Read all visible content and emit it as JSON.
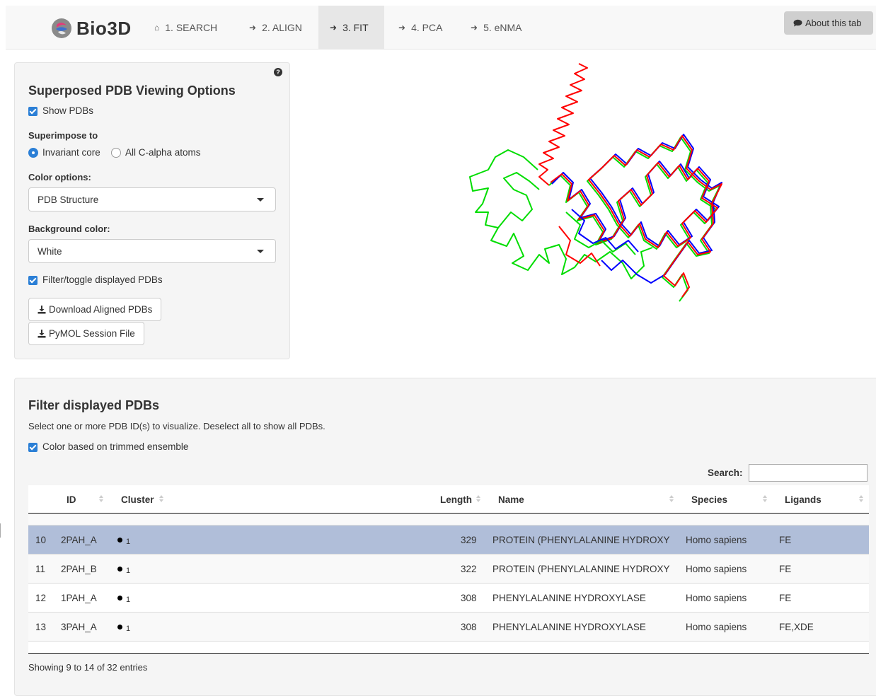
{
  "brand": {
    "name": "Bio3D"
  },
  "nav": {
    "items": [
      {
        "icon": "⌂",
        "label": "1. SEARCH"
      },
      {
        "icon": "➜",
        "label": "2. ALIGN"
      },
      {
        "icon": "➜",
        "label": "3. FIT"
      },
      {
        "icon": "➜",
        "label": "4. PCA"
      },
      {
        "icon": "➜",
        "label": "5. eNMA"
      }
    ],
    "active": "3. FIT",
    "about_label": "About this tab"
  },
  "options": {
    "title": "Superposed PDB Viewing Options",
    "show_pdbs_label": "Show PDBs",
    "show_pdbs_checked": true,
    "superimpose_label": "Superimpose to",
    "superimpose_options": [
      "Invariant core",
      "All C-alpha atoms"
    ],
    "superimpose_selected": "Invariant core",
    "color_label": "Color options:",
    "color_value": "PDB Structure",
    "bg_label": "Background color:",
    "bg_value": "White",
    "filter_toggle_label": "Filter/toggle displayed PDBs",
    "filter_toggle_checked": true,
    "download_button": "Download Aligned PDBs",
    "pymol_button": "PyMOL Session File",
    "help_glyph": "?"
  },
  "viewer": {
    "colors": {
      "red": "#ff0000",
      "green": "#00dd00",
      "blue": "#0000ff"
    }
  },
  "filter": {
    "title": "Filter displayed PDBs",
    "description": "Select one or more PDB ID(s) to visualize. Deselect all to show all PDBs.",
    "trimmed_label": "Color based on trimmed ensemble",
    "trimmed_checked": true,
    "search_label": "Search:",
    "search_value": "",
    "columns": [
      "ID",
      "Cluster",
      "Length",
      "Name",
      "Species",
      "Ligands"
    ],
    "rows": [
      {
        "num": "10",
        "id": "2PAH_A",
        "cluster": "1",
        "length": "329",
        "name": "PROTEIN (PHENYLALANINE HYDROXY",
        "species": "Homo sapiens",
        "ligands": "FE",
        "selected": true
      },
      {
        "num": "11",
        "id": "2PAH_B",
        "cluster": "1",
        "length": "322",
        "name": "PROTEIN (PHENYLALANINE HYDROXY",
        "species": "Homo sapiens",
        "ligands": "FE",
        "selected": false
      },
      {
        "num": "12",
        "id": "1PAH_A",
        "cluster": "1",
        "length": "308",
        "name": "PHENYLALANINE HYDROXYLASE",
        "species": "Homo sapiens",
        "ligands": "FE",
        "selected": false
      },
      {
        "num": "13",
        "id": "3PAH_A",
        "cluster": "1",
        "length": "308",
        "name": "PHENYLALANINE HYDROXYLASE",
        "species": "Homo sapiens",
        "ligands": "FE,XDE",
        "selected": false
      }
    ],
    "info": "Showing 9 to 14 of 32 entries"
  }
}
